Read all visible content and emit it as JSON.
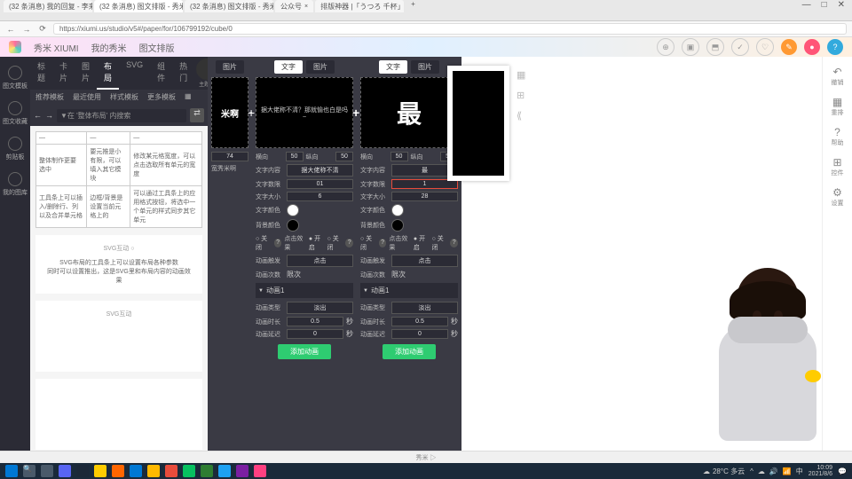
{
  "window": {
    "min": "—",
    "max": "□",
    "close": "✕"
  },
  "tabs": [
    {
      "label": "(32 条消息) 我的回复 - 李来 XIU",
      "active": false
    },
    {
      "label": "(32 条消息) 图文排版 - 秀米 XIU",
      "active": true
    },
    {
      "label": "(32 条消息) 图文排版 - 秀米 XIU",
      "active": false
    },
    {
      "label": "公众号",
      "active": false
    },
    {
      "label": "排版神器 |「うつろ 千杯」-o",
      "active": false
    }
  ],
  "addr": {
    "back": "←",
    "fwd": "→",
    "reload": "⟳",
    "url": "https://xiumi.us/studio/v5#/paper/for/106799192/cube/0"
  },
  "header": {
    "brand": "秀米 XIUMI",
    "nav": [
      "我的秀米",
      "图文排版"
    ],
    "badges": [
      {
        "bg": "#ff9933",
        "t": "✎"
      },
      {
        "bg": "#ff5577",
        "t": "●"
      },
      {
        "bg": "#33aadd",
        "t": "?"
      }
    ]
  },
  "leftbar": [
    {
      "label": "图文模板"
    },
    {
      "label": "图文收藏"
    },
    {
      "label": "剪贴板"
    },
    {
      "label": "我的图库"
    }
  ],
  "panel": {
    "tabs": [
      "标题",
      "卡片",
      "图片",
      "布局",
      "SVG",
      "组件",
      "热门"
    ],
    "active": 3,
    "swatch_label": "主题色",
    "sub": [
      "推荐模板",
      "最近使用",
      "样式模板",
      "更多模板"
    ],
    "search": {
      "placeholder": "▼在 '整体布局' 内搜索",
      "btn": "⇄"
    },
    "table": [
      [
        "—",
        "—",
        "—"
      ],
      [
        "整体制作更要 选中",
        "要元推是小有限，可以填入其它模块",
        "修改某元格宽度，可以点击选取所有单元的宽度"
      ],
      [
        "工具条上可以插入/删除行、列以及合并单元格",
        "边框/背景是设置当前元格上的",
        "可以通过工具条上的应用格式按钮，将选中一个单元的样式同步其它单元"
      ]
    ],
    "svgcard": {
      "title": "SVG互动 ○",
      "line1": "SVG布局的工具条上可以设置布局各种参数",
      "line2": "同时可以设置推出，这是SVG里和布局内容的动画效果"
    },
    "svgcard2": {
      "title": "SVG互动"
    }
  },
  "p1_tail": {
    "num": "74",
    "label": "宽秀米啊"
  },
  "p2": {
    "tab_text": "文字",
    "tab_img": "图片",
    "img_caption": "据大佬称不清？那就愉也白是吗~",
    "hx_l": "横向",
    "hx_v": "50",
    "zy_l": "纵向",
    "zy_v": "50",
    "txt_l": "文字内容",
    "txt_v": "据大佬称不清",
    "num_l": "文字数限",
    "num_v": "01",
    "size_l": "文字大小",
    "size_v": "6",
    "color_l": "文字颜色",
    "color_v": "#ffffff",
    "bg_l": "背景颜色",
    "bg_v": "#000000",
    "close_l": "○ 关闭",
    "click_l": "点击效果",
    "click_open": "● 开启",
    "click_close": "○ 关闭",
    "trig_l": "动画触发",
    "trig_v": "点击",
    "cnt_l": "动画次数",
    "cnt_v": "限次",
    "sec": "动画1",
    "type_l": "动画类型",
    "type_v": "淡出",
    "dur_l": "动画时长",
    "dur_v": "0.5",
    "dur_u": "秒",
    "delay_l": "动画延迟",
    "delay_v": "0",
    "delay_u": "秒",
    "addbtn": "添加动画"
  },
  "p3": {
    "tab_text": "文字",
    "tab_img": "图片",
    "big_char": "最",
    "hx_l": "横向",
    "hx_v": "50",
    "zy_l": "纵向",
    "zy_v": "50",
    "txt_l": "文字内容",
    "txt_v": "最",
    "num_l": "文字数限",
    "num_v": "1",
    "size_l": "文字大小",
    "size_v": "28",
    "color_l": "文字颜色",
    "color_v": "#ffffff",
    "bg_l": "背景颜色",
    "bg_v": "#000000",
    "close_l": "○ 关闭",
    "click_l": "点击效果",
    "click_open": "● 开启",
    "click_close": "○ 关闭",
    "trig_l": "动画触发",
    "trig_v": "点击",
    "cnt_l": "动画次数",
    "cnt_v": "限次",
    "sec": "动画1",
    "type_l": "动画类型",
    "type_v": "淡出",
    "dur_l": "动画时长",
    "dur_v": "0.5",
    "dur_u": "秒",
    "delay_l": "动画延迟",
    "delay_v": "0",
    "delay_u": "秒",
    "addbtn": "添加动画"
  },
  "rtool": [
    {
      "ico": "↶",
      "label": "撤销"
    },
    {
      "ico": "▦",
      "label": "重排"
    },
    {
      "ico": "?",
      "label": "帮助"
    },
    {
      "ico": "⊞",
      "label": "控件"
    },
    {
      "ico": "⚙",
      "label": "设置"
    }
  ],
  "mid_icons": [
    "▦",
    "⊞",
    "⟪"
  ],
  "status": {
    "mid": "秀米 ▷"
  },
  "taskbar": {
    "weather": "28°C 多云",
    "time": "10:09",
    "date": "2021/8/6"
  }
}
